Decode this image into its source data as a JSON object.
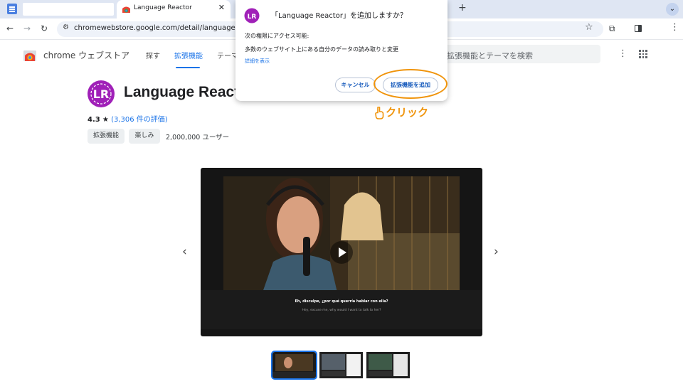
{
  "browser": {
    "tab_title": "Language Reactor",
    "tab_close": "✕",
    "tab_new": "+",
    "tab_menu": "⌄",
    "url": "chromewebstore.google.com/detail/language-react",
    "nav_back": "←",
    "nav_forward": "→",
    "nav_reload": "↻",
    "star": "☆",
    "more": "⋮",
    "icons": [
      "app-icon",
      "extensions-icon",
      "side-panel-icon",
      "tune-icon"
    ]
  },
  "store": {
    "name": "chrome ウェブストア",
    "nav": [
      "探す",
      "拡張機能",
      "テーマ"
    ],
    "active_nav": "拡張機能",
    "search_placeholder": "拡張機能とテーマを検索",
    "more": "⋮"
  },
  "extension": {
    "name": "Language Reactor",
    "rating": "4.3",
    "star": "★",
    "reviews": "(3,306 件の評価)",
    "chips": [
      "拡張機能",
      "楽しみ"
    ],
    "users": "2,000,000 ユーザー",
    "subtitle_line1": "Eh, disculpe, ¿por qué querría hablar con ella?",
    "subtitle_line2": "Hey, excuse me, why would I want to talk to her?",
    "prev_arrow": "‹",
    "next_arrow": "›"
  },
  "dialog": {
    "title": "「Language Reactor」を追加しますか？",
    "permissions_heading": "次の権限にアクセス可能:",
    "permission": "多数のウェブサイト上にある自分のデータの読み取りと変更",
    "details_link": "詳細を表示",
    "cancel": "キャンセル",
    "add": "拡張機能を追加"
  },
  "annotation": {
    "click_label": "クリック",
    "color": "#f0940b"
  },
  "colors": {
    "accent": "#1a73e8",
    "logo": "#a020b8",
    "highlight": "#f0940b"
  }
}
